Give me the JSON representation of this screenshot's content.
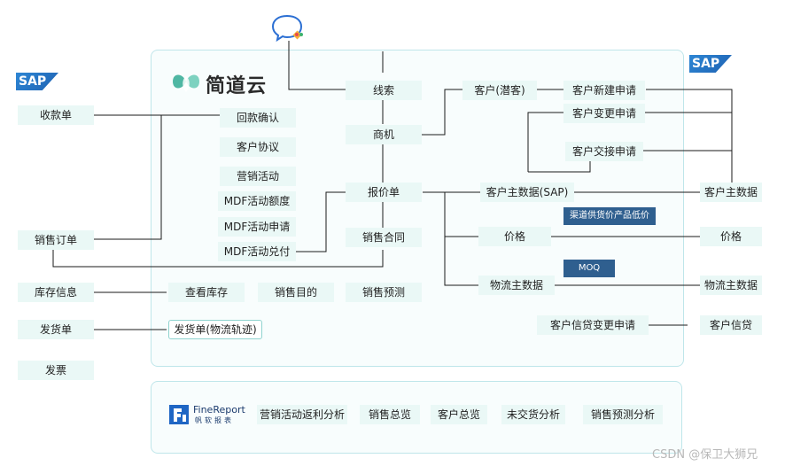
{
  "brand": {
    "jdy_name": "简道云",
    "sap_label": "SAP",
    "finereport_name": "FineReport",
    "finereport_sub": "帆软报表",
    "jdy_color": "#4fb7a3",
    "sap_color": "#2d86d4",
    "panel_border": "#bfe6ea",
    "node_fill": "#eaf8f6",
    "tag_fill": "#2f5f8f"
  },
  "sap_left": [
    "收款单",
    "销售订单",
    "库存信息",
    "发货单",
    "发票"
  ],
  "jdy": {
    "col1": [
      "回款确认",
      "客户协议",
      "营销活动",
      "MDF活动额度",
      "MDF活动申请",
      "MDF活动兑付",
      "查看库存",
      "发货单(物流轨迹)",
      "销售目的"
    ],
    "col2": [
      "线索",
      "商机",
      "报价单",
      "销售合同",
      "销售预测"
    ],
    "col3": [
      "客户(潜客)",
      "客户新建申请",
      "客户变更申请",
      "客户交接申请",
      "客户主数据(SAP)",
      "价格",
      "物流主数据",
      "客户信贷变更申请"
    ],
    "tags": [
      "渠道供货价产品低价",
      "MOQ"
    ]
  },
  "sap_right": [
    "客户主数据",
    "价格",
    "物流主数据",
    "客户信贷"
  ],
  "reports": [
    "营销活动返利分析",
    "销售总览",
    "客户总览",
    "未交货分析",
    "销售预测分析"
  ],
  "watermark": "CSDN @保卫大狮兄",
  "icons": [
    "chat-bubble-icon",
    "leaf-logo-icon",
    "sap-logo-icon",
    "finereport-logo-icon"
  ]
}
